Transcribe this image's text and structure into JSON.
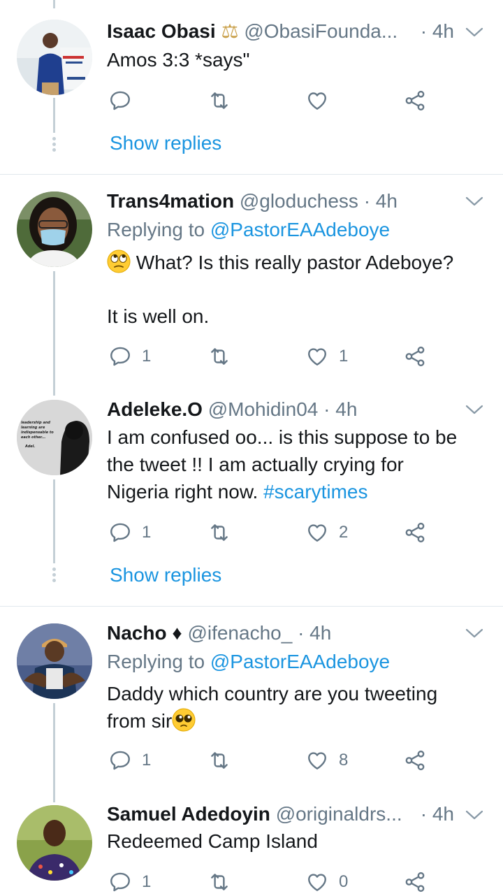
{
  "tweets": [
    {
      "name": "Isaac Obasi",
      "name_suffix": "⚖",
      "handle": "@ObasiFounda...",
      "time": "· 4h",
      "text": "Amos 3:3 *says\"",
      "reply_count": "",
      "retweet_count": "",
      "like_count": "",
      "show_replies": "Show replies"
    },
    {
      "name": "Trans4mation",
      "handle": "@gloduchess",
      "time": "· 4h",
      "replying_prefix": "Replying to ",
      "replying_to": "@PastorEAAdeboye",
      "text_line1": "What? Is this really pastor Adeboye?",
      "text_line2": "It is well on.",
      "reply_count": "1",
      "retweet_count": "",
      "like_count": "1"
    },
    {
      "name": "Adeleke.O",
      "handle": "@Mohidin04",
      "time": "· 4h",
      "text_line1": "I am confused oo... is this suppose to be",
      "text_line2": "the tweet !! I am actually crying for",
      "text_line3": "Nigeria right now. ",
      "hashtag": "#scarytimes",
      "reply_count": "1",
      "retweet_count": "",
      "like_count": "2",
      "show_replies": "Show replies",
      "avatar_text_lines": [
        "leadership and",
        "learning are",
        "indispensable to",
        "each other..."
      ],
      "avatar_signature": "Adel."
    },
    {
      "name": "Nacho",
      "name_suffix": "♦",
      "handle": "@ifenacho_",
      "time": "· 4h",
      "replying_prefix": "Replying to ",
      "replying_to": "@PastorEAAdeboye",
      "text_line1": "Daddy which country are you tweeting",
      "text_line2": "from sir",
      "reply_count": "1",
      "retweet_count": "",
      "like_count": "8"
    },
    {
      "name": "Samuel Adedoyin",
      "handle": "@originaldrs...",
      "time": "· 4h",
      "text": "Redeemed Camp Island",
      "reply_count": "1",
      "retweet_count": "",
      "like_count": "0"
    }
  ],
  "colors": {
    "link": "#1b95e0",
    "muted": "#657786",
    "divider": "#e1e8ed",
    "thread_line": "#c4cfd6"
  },
  "icons": [
    "reply-icon",
    "retweet-icon",
    "like-icon",
    "share-icon",
    "chevron-down-icon",
    "balance-scale-icon",
    "diamond-icon",
    "eye-roll-emoji",
    "pleading-face-emoji"
  ]
}
